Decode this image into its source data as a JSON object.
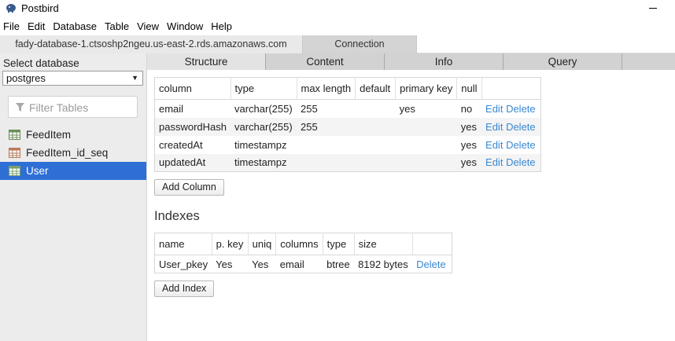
{
  "window": {
    "title": "Postbird"
  },
  "menu": [
    "File",
    "Edit",
    "Database",
    "Table",
    "View",
    "Window",
    "Help"
  ],
  "connection_tabs": [
    {
      "label": "fady-database-1.ctsoshp2ngeu.us-east-2.rds.amazonaws.com",
      "active": true
    },
    {
      "label": "Connection",
      "active": false
    }
  ],
  "sidebar": {
    "db_label": "Select database",
    "selected_db": "postgres",
    "filter_placeholder": "Filter Tables",
    "tables": [
      {
        "name": "FeedItem",
        "icon": "table-icon",
        "selected": false
      },
      {
        "name": "FeedItem_id_seq",
        "icon": "sequence-icon",
        "selected": false
      },
      {
        "name": "User",
        "icon": "table-icon",
        "selected": true
      }
    ]
  },
  "content_tabs": [
    {
      "label": "Structure",
      "active": true
    },
    {
      "label": "Content",
      "active": false
    },
    {
      "label": "Info",
      "active": false
    },
    {
      "label": "Query",
      "active": false
    }
  ],
  "structure": {
    "headers": [
      "column",
      "type",
      "max length",
      "default",
      "primary key",
      "null"
    ],
    "rows": [
      {
        "column": "email",
        "type": "varchar(255)",
        "max_length": "255",
        "default": "",
        "primary_key": "yes",
        "null": "no"
      },
      {
        "column": "passwordHash",
        "type": "varchar(255)",
        "max_length": "255",
        "default": "",
        "primary_key": "",
        "null": "yes"
      },
      {
        "column": "createdAt",
        "type": "timestampz",
        "max_length": "",
        "default": "",
        "primary_key": "",
        "null": "yes"
      },
      {
        "column": "updatedAt",
        "type": "timestampz",
        "max_length": "",
        "default": "",
        "primary_key": "",
        "null": "yes"
      }
    ],
    "edit_label": "Edit",
    "delete_label": "Delete",
    "add_column_label": "Add Column"
  },
  "indexes": {
    "title": "Indexes",
    "headers": [
      "name",
      "p. key",
      "uniq",
      "columns",
      "type",
      "size"
    ],
    "rows": [
      {
        "name": "User_pkey",
        "p_key": "Yes",
        "uniq": "Yes",
        "columns": "email",
        "type": "btree",
        "size": "8192 bytes"
      }
    ],
    "delete_label": "Delete",
    "add_index_label": "Add Index"
  },
  "colors": {
    "accent": "#2e6fd6",
    "link": "#3a88d2",
    "sidebar_bg": "#ececec"
  }
}
